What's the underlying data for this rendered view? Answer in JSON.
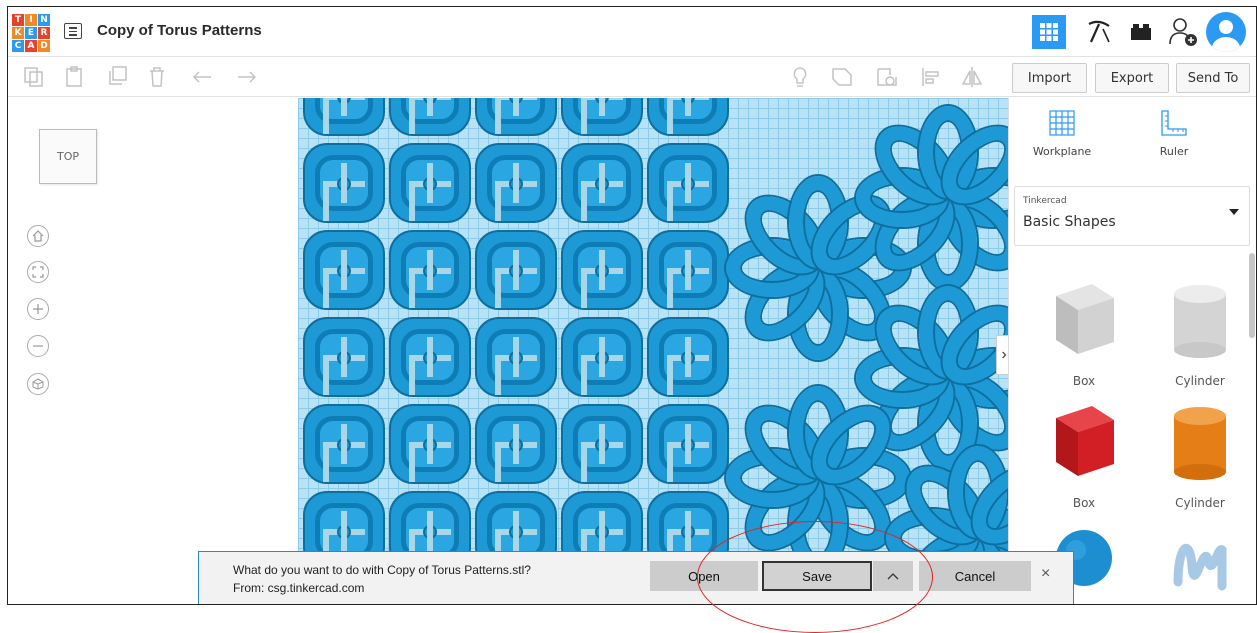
{
  "app": {
    "document_title": "Copy of Torus Patterns",
    "logo_letters": [
      "T",
      "I",
      "N",
      "K",
      "E",
      "R",
      "C",
      "A",
      "D"
    ],
    "logo_colors": [
      "#e8412c",
      "#f08a24",
      "#2b9af3",
      "#f08a24",
      "#2b9af3",
      "#e8412c",
      "#2b9af3",
      "#e8412c",
      "#f08a24"
    ]
  },
  "header": {
    "view_icons": [
      "grid-view-icon",
      "pickaxe-icon",
      "bricks-icon",
      "add-user-icon",
      "avatar"
    ],
    "accent": "#2b9af3"
  },
  "toolbar": {
    "edit_icons": [
      "copy-icon",
      "paste-icon",
      "duplicate-icon",
      "delete-icon",
      "undo-icon",
      "redo-icon"
    ],
    "right_icons": [
      "light-bulb-icon",
      "group-icon",
      "ungroup-icon",
      "align-icon",
      "mirror-icon"
    ],
    "import_label": "Import",
    "export_label": "Export",
    "send_to_label": "Send To"
  },
  "view_controls": {
    "view_cube_label": "TOP",
    "buttons": [
      "home-view-icon",
      "fit-view-icon",
      "zoom-in-icon",
      "zoom-out-icon",
      "perspective-icon"
    ]
  },
  "right_panel": {
    "workplane_label": "Workplane",
    "ruler_label": "Ruler",
    "library_provider": "Tinkercad",
    "library_name": "Basic Shapes",
    "shapes": [
      {
        "label": "Box",
        "color": "#cfcfcf"
      },
      {
        "label": "Cylinder",
        "color": "#d8d8d8"
      },
      {
        "label": "Box",
        "color": "#d21f25"
      },
      {
        "label": "Cylinder",
        "color": "#e57e16"
      },
      {
        "label": "",
        "color": "#1d8fd0"
      },
      {
        "label": "",
        "color": "#a7c9e6"
      }
    ]
  },
  "download_bar": {
    "question": "What do you want to do with Copy of Torus Patterns.stl?",
    "source": "From: csg.tinkercad.com",
    "open_label": "Open",
    "save_label": "Save",
    "more_label": "^",
    "cancel_label": "Cancel",
    "close_label": "×"
  },
  "annotation": {
    "color": "#e0241f"
  }
}
